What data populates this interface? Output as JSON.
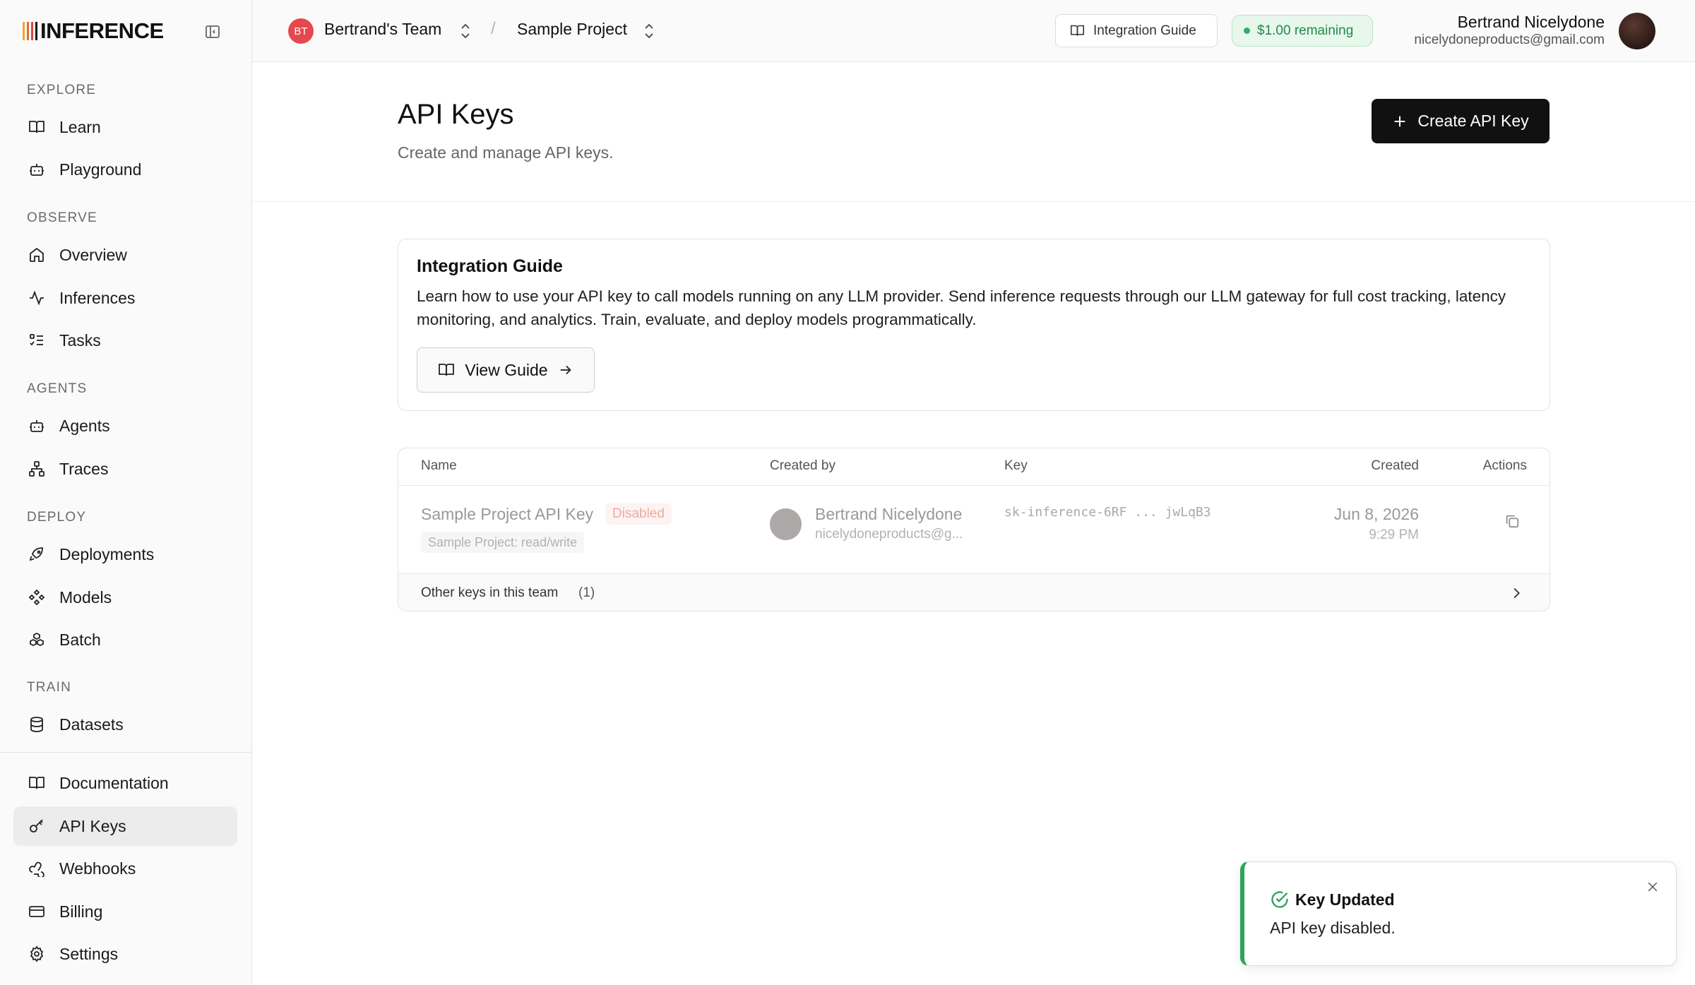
{
  "app": {
    "brand_name": "INFERENCE",
    "brand_bar_colors": [
      "#f5a623",
      "#e8663d",
      "#d94c3a",
      "#111111"
    ]
  },
  "sidebar": {
    "sections": [
      {
        "label": "EXPLORE",
        "items": [
          {
            "label": "Learn",
            "icon": "book-open-icon"
          },
          {
            "label": "Playground",
            "icon": "bot-icon"
          }
        ]
      },
      {
        "label": "OBSERVE",
        "items": [
          {
            "label": "Overview",
            "icon": "home-icon"
          },
          {
            "label": "Inferences",
            "icon": "activity-icon"
          },
          {
            "label": "Tasks",
            "icon": "list-todo-icon"
          }
        ]
      },
      {
        "label": "AGENTS",
        "items": [
          {
            "label": "Agents",
            "icon": "bot-icon"
          },
          {
            "label": "Traces",
            "icon": "workflow-icon"
          }
        ]
      },
      {
        "label": "DEPLOY",
        "items": [
          {
            "label": "Deployments",
            "icon": "rocket-icon"
          },
          {
            "label": "Models",
            "icon": "diamond-cluster-icon"
          },
          {
            "label": "Batch",
            "icon": "boxes-icon"
          }
        ]
      },
      {
        "label": "TRAIN",
        "items": [
          {
            "label": "Datasets",
            "icon": "database-icon"
          }
        ]
      }
    ],
    "footer_items": [
      {
        "label": "Documentation",
        "icon": "book-open-icon"
      },
      {
        "label": "API Keys",
        "icon": "key-icon",
        "active": true
      },
      {
        "label": "Webhooks",
        "icon": "webhook-icon"
      },
      {
        "label": "Billing",
        "icon": "credit-card-icon"
      },
      {
        "label": "Settings",
        "icon": "gear-icon"
      }
    ]
  },
  "header": {
    "team_initials": "BT",
    "team_name": "Bertrand's Team",
    "separator": "/",
    "project_name": "Sample Project",
    "guide_button": "Integration Guide",
    "credits": "$1.00 remaining",
    "user_name": "Bertrand Nicelydone",
    "user_email": "nicelydoneproducts@gmail.com"
  },
  "page": {
    "title": "API Keys",
    "subtitle": "Create and manage API keys.",
    "create_button": "Create API Key"
  },
  "guide_card": {
    "title": "Integration Guide",
    "body": "Learn how to use your API key to call models running on any LLM provider. Send inference requests through our LLM gateway for full cost tracking, latency monitoring, and analytics. Train, evaluate, and deploy models programmatically.",
    "button": "View Guide"
  },
  "keys_table": {
    "columns": [
      "Name",
      "Created by",
      "Key",
      "Created",
      "Actions"
    ],
    "rows": [
      {
        "name": "Sample Project API Key",
        "status": "Disabled",
        "scope": "Sample Project: read/write",
        "creator_name": "Bertrand Nicelydone",
        "creator_email": "nicelydoneproducts@g...",
        "key": "sk-inference-6RF ... jwLqB3",
        "created_date": "Jun 8, 2026",
        "created_time": "9:29 PM"
      }
    ],
    "other_keys_label": "Other keys in this team",
    "other_keys_count": "(1)"
  },
  "toast": {
    "title": "Key Updated",
    "message": "API key disabled.",
    "accent": "#2fa35c"
  }
}
